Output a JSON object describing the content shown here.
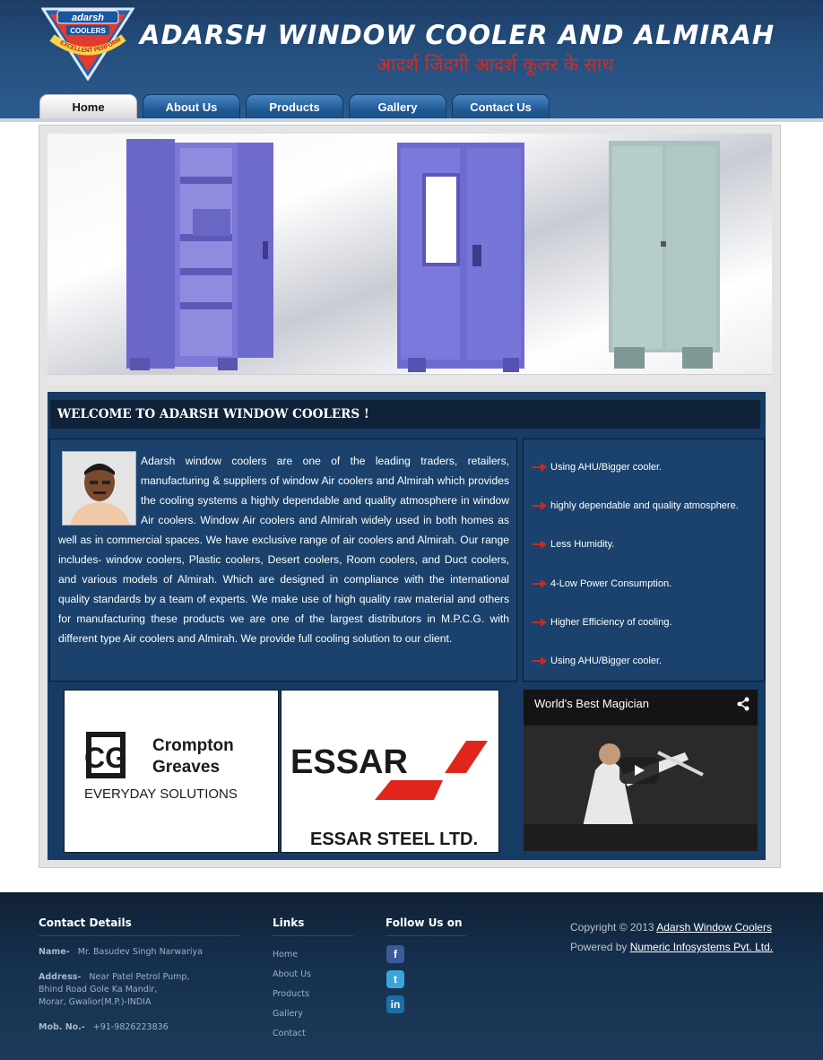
{
  "header": {
    "logo_text": "adarsh",
    "logo_subtext": "COOLERS",
    "logo_ribbon": "EXCELLENT PERFORMANCE",
    "title": "ADARSH WINDOW COOLER AND ALMIRAH",
    "tagline": "आदर्श जिंदगी आदर्श कूलर के साथ"
  },
  "nav": {
    "items": [
      {
        "label": "Home",
        "active": true
      },
      {
        "label": "About Us",
        "active": false
      },
      {
        "label": "Products",
        "active": false
      },
      {
        "label": "Gallery",
        "active": false
      },
      {
        "label": "Contact Us",
        "active": false
      }
    ]
  },
  "welcome": {
    "title": "WELCOME TO ADARSH WINDOW COOLERS !",
    "about_text": "Adarsh window coolers are one of the leading traders, retailers, manufacturing & suppliers of window Air coolers and Almirah which provides the cooling systems a highly dependable and quality atmosphere in window Air coolers. Window Air coolers and Almirah widely used in both homes as well as in commercial spaces. We have exclusive range of air coolers and Almirah. Our range includes- window coolers, Plastic coolers, Desert coolers, Room coolers, and Duct coolers, and various models of Almirah. Which are designed in compliance with the international quality standards by a team of experts. We make use of high quality raw material and others for manufacturing these products we are one of the largest distributors in M.P.C.G. with different type Air coolers and Almirah. We provide full cooling solution to our client."
  },
  "features": [
    "Using AHU/Bigger cooler.",
    "highly dependable and quality atmosphere.",
    "Less Humidity.",
    "4-Low Power Consumption.",
    "Higher Efficiency of cooling.",
    "Using AHU/Bigger cooler."
  ],
  "partners": {
    "cg_initials": "CG",
    "cg_name_1": "Crompton",
    "cg_name_2": "Greaves",
    "cg_slogan": "EVERYDAY SOLUTIONS",
    "essar_name": "ESSAR",
    "essar_caption": "ESSAR STEEL LTD."
  },
  "video": {
    "title": "World's Best Magician"
  },
  "footer": {
    "contact_heading": "Contact Details",
    "name_label": "Name-",
    "name_value": "Mr. Basudev Singh Narwariya",
    "address_label": "Address-",
    "address_line1": "Near Patel Petrol Pump,",
    "address_line2": "Bhind Road Gole Ka Mandir,",
    "address_line3": "Morar, Gwalior(M.P.)-INDIA",
    "mobile_label": "Mob. No.-",
    "mobile_value": "+91-9826223836",
    "links_heading": "Links",
    "links": [
      "Home",
      "About Us",
      "Products",
      "Gallery",
      "Contact"
    ],
    "follow_heading": "Follow Us on",
    "copyright_prefix": "Copyright © 2013",
    "copyright_link": "Adarsh Window Coolers",
    "powered_prefix": "Powered by",
    "powered_link": "Numeric Infosystems Pvt. Ltd."
  },
  "colors": {
    "header_blue": "#24507f",
    "content_navy": "#163b64",
    "accent_red": "#d62a22"
  }
}
